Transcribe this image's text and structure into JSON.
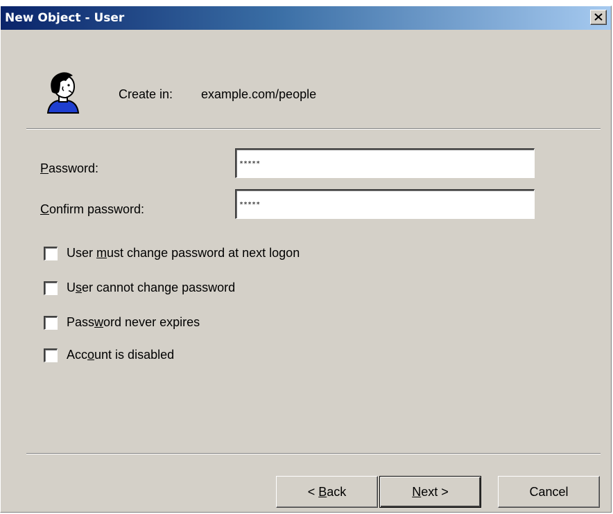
{
  "window": {
    "title": "New Object - User"
  },
  "header": {
    "create_label": "Create in:",
    "create_value": "example.com/people"
  },
  "fields": {
    "password": {
      "label_accel": "P",
      "label_rest": "assword:",
      "value": "*****"
    },
    "confirm": {
      "label_accel": "C",
      "label_rest": "onfirm password:",
      "value": "*****"
    }
  },
  "options": [
    {
      "pre": "User ",
      "accel": "m",
      "post": "ust change password at next logon",
      "checked": false
    },
    {
      "pre": "U",
      "accel": "s",
      "post": "er cannot change password",
      "checked": false
    },
    {
      "pre": "Pass",
      "accel": "w",
      "post": "ord never expires",
      "checked": false
    },
    {
      "pre": "Acc",
      "accel": "o",
      "post": "unt is disabled",
      "checked": false
    }
  ],
  "buttons": {
    "back": {
      "pre": "< ",
      "accel": "B",
      "post": "ack"
    },
    "next": {
      "pre": "",
      "accel": "N",
      "post": "ext >"
    },
    "cancel": "Cancel"
  }
}
